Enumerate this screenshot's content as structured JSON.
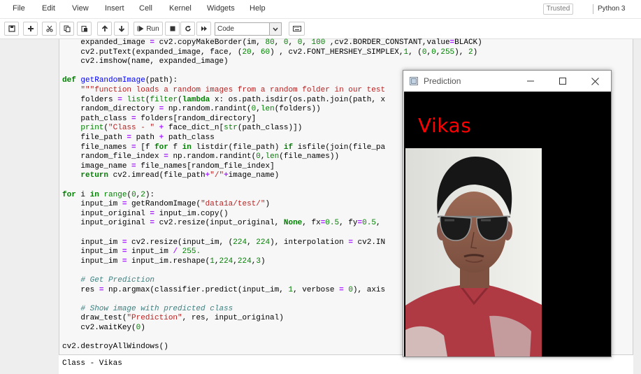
{
  "menu": {
    "items": [
      "File",
      "Edit",
      "View",
      "Insert",
      "Cell",
      "Kernel",
      "Widgets",
      "Help"
    ],
    "trusted_label": "Trusted",
    "kernel_label": "Python 3"
  },
  "toolbar": {
    "run_label": "Run",
    "cell_type": "Code",
    "icons": [
      "save-icon",
      "plus-icon",
      "cut-icon",
      "copy-icon",
      "paste-icon",
      "arrow-up-icon",
      "arrow-down-icon",
      "run-icon",
      "stop-icon",
      "restart-icon",
      "fast-forward-icon",
      "keyboard-icon"
    ]
  },
  "code": {
    "lines": [
      "    expanded_image = cv2.copyMakeBorder(im, 80, 0, 0, 100 ,cv2.BORDER_CONSTANT,value=BLACK)",
      "    cv2.putText(expanded_image, face, (20, 60) , cv2.FONT_HERSHEY_SIMPLEX,1, (0,0,255), 2)",
      "    cv2.imshow(name, expanded_image)",
      "",
      "def getRandomImage(path):",
      "    \"\"\"function loads a random images from a random folder in our test",
      "    folders = list(filter(lambda x: os.path.isdir(os.path.join(path, x",
      "    random_directory = np.random.randint(0,len(folders))",
      "    path_class = folders[random_directory]",
      "    print(\"Class - \" + face_dict_n[str(path_class)])",
      "    file_path = path + path_class",
      "    file_names = [f for f in listdir(file_path) if isfile(join(file_pa",
      "    random_file_index = np.random.randint(0,len(file_names))",
      "    image_name = file_names[random_file_index]",
      "    return cv2.imread(file_path+\"/\"+image_name)",
      "",
      "for i in range(0,2):",
      "    input_im = getRandomImage(\"data1a/test/\")",
      "    input_original = input_im.copy()",
      "    input_original = cv2.resize(input_original, None, fx=0.5, fy=0.5,",
      "",
      "    input_im = cv2.resize(input_im, (224, 224), interpolation = cv2.IN",
      "    input_im = input_im / 255.",
      "    input_im = input_im.reshape(1,224,224,3)",
      "",
      "    # Get Prediction",
      "    res = np.argmax(classifier.predict(input_im, 1, verbose = 0), axis",
      "",
      "    # Show image with predicted class",
      "    draw_test(\"Prediction\", res, input_original)",
      "    cv2.waitKey(0)",
      "",
      "cv2.destroyAllWindows()"
    ],
    "output": "Class - Vikas"
  },
  "window": {
    "title": "Prediction",
    "predicted_label": "Vikas",
    "label_color": "#ff0000"
  }
}
